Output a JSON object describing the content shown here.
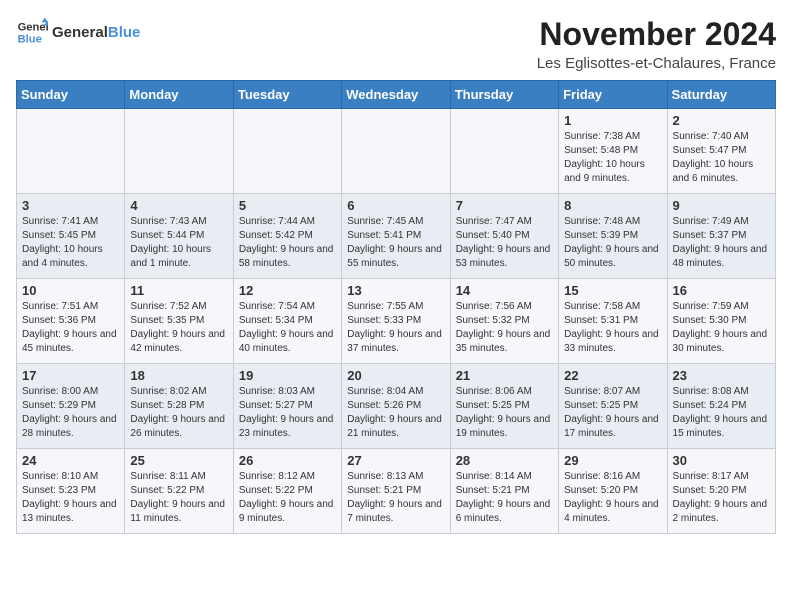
{
  "logo": {
    "line1": "General",
    "line2": "Blue"
  },
  "title": "November 2024",
  "subtitle": "Les Eglisottes-et-Chalaures, France",
  "days_of_week": [
    "Sunday",
    "Monday",
    "Tuesday",
    "Wednesday",
    "Thursday",
    "Friday",
    "Saturday"
  ],
  "weeks": [
    [
      {
        "day": "",
        "info": ""
      },
      {
        "day": "",
        "info": ""
      },
      {
        "day": "",
        "info": ""
      },
      {
        "day": "",
        "info": ""
      },
      {
        "day": "",
        "info": ""
      },
      {
        "day": "1",
        "info": "Sunrise: 7:38 AM\nSunset: 5:48 PM\nDaylight: 10 hours and 9 minutes."
      },
      {
        "day": "2",
        "info": "Sunrise: 7:40 AM\nSunset: 5:47 PM\nDaylight: 10 hours and 6 minutes."
      }
    ],
    [
      {
        "day": "3",
        "info": "Sunrise: 7:41 AM\nSunset: 5:45 PM\nDaylight: 10 hours and 4 minutes."
      },
      {
        "day": "4",
        "info": "Sunrise: 7:43 AM\nSunset: 5:44 PM\nDaylight: 10 hours and 1 minute."
      },
      {
        "day": "5",
        "info": "Sunrise: 7:44 AM\nSunset: 5:42 PM\nDaylight: 9 hours and 58 minutes."
      },
      {
        "day": "6",
        "info": "Sunrise: 7:45 AM\nSunset: 5:41 PM\nDaylight: 9 hours and 55 minutes."
      },
      {
        "day": "7",
        "info": "Sunrise: 7:47 AM\nSunset: 5:40 PM\nDaylight: 9 hours and 53 minutes."
      },
      {
        "day": "8",
        "info": "Sunrise: 7:48 AM\nSunset: 5:39 PM\nDaylight: 9 hours and 50 minutes."
      },
      {
        "day": "9",
        "info": "Sunrise: 7:49 AM\nSunset: 5:37 PM\nDaylight: 9 hours and 48 minutes."
      }
    ],
    [
      {
        "day": "10",
        "info": "Sunrise: 7:51 AM\nSunset: 5:36 PM\nDaylight: 9 hours and 45 minutes."
      },
      {
        "day": "11",
        "info": "Sunrise: 7:52 AM\nSunset: 5:35 PM\nDaylight: 9 hours and 42 minutes."
      },
      {
        "day": "12",
        "info": "Sunrise: 7:54 AM\nSunset: 5:34 PM\nDaylight: 9 hours and 40 minutes."
      },
      {
        "day": "13",
        "info": "Sunrise: 7:55 AM\nSunset: 5:33 PM\nDaylight: 9 hours and 37 minutes."
      },
      {
        "day": "14",
        "info": "Sunrise: 7:56 AM\nSunset: 5:32 PM\nDaylight: 9 hours and 35 minutes."
      },
      {
        "day": "15",
        "info": "Sunrise: 7:58 AM\nSunset: 5:31 PM\nDaylight: 9 hours and 33 minutes."
      },
      {
        "day": "16",
        "info": "Sunrise: 7:59 AM\nSunset: 5:30 PM\nDaylight: 9 hours and 30 minutes."
      }
    ],
    [
      {
        "day": "17",
        "info": "Sunrise: 8:00 AM\nSunset: 5:29 PM\nDaylight: 9 hours and 28 minutes."
      },
      {
        "day": "18",
        "info": "Sunrise: 8:02 AM\nSunset: 5:28 PM\nDaylight: 9 hours and 26 minutes."
      },
      {
        "day": "19",
        "info": "Sunrise: 8:03 AM\nSunset: 5:27 PM\nDaylight: 9 hours and 23 minutes."
      },
      {
        "day": "20",
        "info": "Sunrise: 8:04 AM\nSunset: 5:26 PM\nDaylight: 9 hours and 21 minutes."
      },
      {
        "day": "21",
        "info": "Sunrise: 8:06 AM\nSunset: 5:25 PM\nDaylight: 9 hours and 19 minutes."
      },
      {
        "day": "22",
        "info": "Sunrise: 8:07 AM\nSunset: 5:25 PM\nDaylight: 9 hours and 17 minutes."
      },
      {
        "day": "23",
        "info": "Sunrise: 8:08 AM\nSunset: 5:24 PM\nDaylight: 9 hours and 15 minutes."
      }
    ],
    [
      {
        "day": "24",
        "info": "Sunrise: 8:10 AM\nSunset: 5:23 PM\nDaylight: 9 hours and 13 minutes."
      },
      {
        "day": "25",
        "info": "Sunrise: 8:11 AM\nSunset: 5:22 PM\nDaylight: 9 hours and 11 minutes."
      },
      {
        "day": "26",
        "info": "Sunrise: 8:12 AM\nSunset: 5:22 PM\nDaylight: 9 hours and 9 minutes."
      },
      {
        "day": "27",
        "info": "Sunrise: 8:13 AM\nSunset: 5:21 PM\nDaylight: 9 hours and 7 minutes."
      },
      {
        "day": "28",
        "info": "Sunrise: 8:14 AM\nSunset: 5:21 PM\nDaylight: 9 hours and 6 minutes."
      },
      {
        "day": "29",
        "info": "Sunrise: 8:16 AM\nSunset: 5:20 PM\nDaylight: 9 hours and 4 minutes."
      },
      {
        "day": "30",
        "info": "Sunrise: 8:17 AM\nSunset: 5:20 PM\nDaylight: 9 hours and 2 minutes."
      }
    ]
  ]
}
